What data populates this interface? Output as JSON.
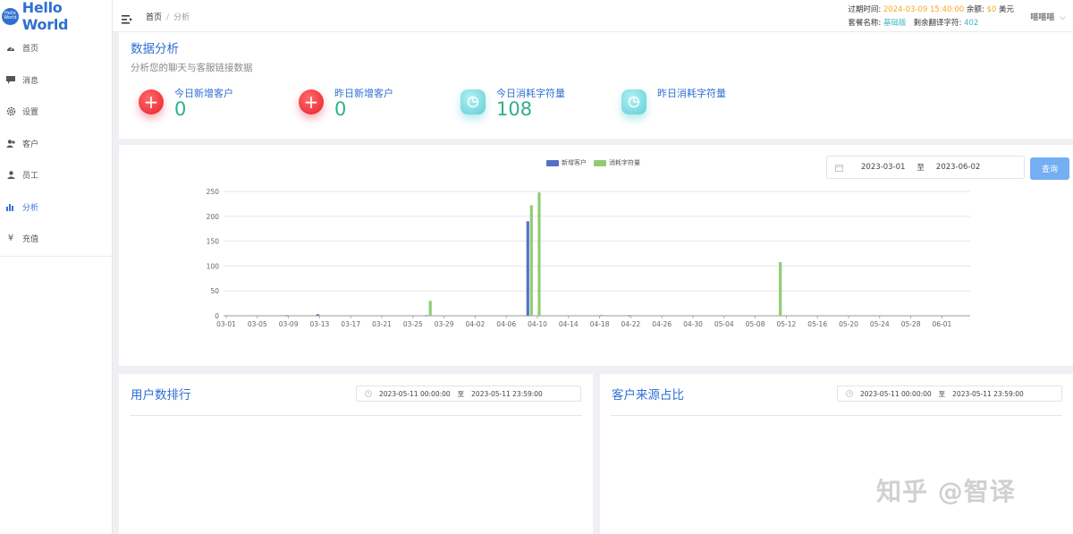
{
  "logo": {
    "badge": "Hello World",
    "text": "Hello World"
  },
  "sidebar": {
    "items": [
      {
        "label": "首页",
        "icon": "dashboard-icon"
      },
      {
        "label": "消息",
        "icon": "message-icon"
      },
      {
        "label": "设置",
        "icon": "gear-icon"
      },
      {
        "label": "客户",
        "icon": "users-icon"
      },
      {
        "label": "员工",
        "icon": "user-icon"
      },
      {
        "label": "分析",
        "icon": "bar-chart-icon",
        "active": true
      },
      {
        "label": "充值",
        "icon": "yen-icon"
      }
    ]
  },
  "header": {
    "breadcrumb": {
      "home": "首页",
      "sep": "/",
      "current": "分析"
    },
    "expiry_label": "过期时间:",
    "expiry_value": "2024-03-09 15:40:00",
    "balance_label": "余额:",
    "balance_value": "$0",
    "balance_unit": "美元",
    "plan_label": "套餐名称:",
    "plan_value": "基础版",
    "chars_label": "剩余翻译字符:",
    "chars_value": "402",
    "user": "喵喵喵"
  },
  "stats_panel": {
    "title": "数据分析",
    "subtitle": "分析您的聊天与客服链接数据",
    "stats": [
      {
        "label": "今日新增客户",
        "value": "0",
        "icon": "plus-icon"
      },
      {
        "label": "昨日新增客户",
        "value": "0",
        "icon": "plus-icon"
      },
      {
        "label": "今日消耗字符量",
        "value": "108",
        "icon": "pie-icon"
      },
      {
        "label": "昨日消耗字符量",
        "value": "",
        "icon": "pie-icon"
      }
    ]
  },
  "chart_panel": {
    "date_from": "2023-03-01",
    "date_to_sep": "至",
    "date_to": "2023-06-02",
    "query_button": "查询"
  },
  "chart_data": {
    "type": "bar",
    "title": "",
    "xlabel": "",
    "ylabel": "",
    "ylim": [
      0,
      250
    ],
    "yticks": [
      0,
      50,
      100,
      150,
      200,
      250
    ],
    "grid": true,
    "legend_position": "top-center",
    "x_tick_labels": [
      "03-01",
      "03-05",
      "03-09",
      "03-13",
      "03-17",
      "03-21",
      "03-25",
      "03-29",
      "04-02",
      "04-06",
      "04-10",
      "04-14",
      "04-18",
      "04-22",
      "04-26",
      "04-30",
      "05-04",
      "05-08",
      "05-12",
      "05-16",
      "05-20",
      "05-24",
      "05-28",
      "06-01"
    ],
    "x_start": "2023-03-01",
    "x_end": "2023-06-02",
    "series": [
      {
        "name": "新增客户",
        "color": "#5470c6",
        "points": [
          {
            "date": "2023-03-09",
            "value": 1
          },
          {
            "date": "2023-03-13",
            "value": 3
          },
          {
            "date": "2023-03-27",
            "value": 1
          },
          {
            "date": "2023-04-09",
            "value": 190
          },
          {
            "date": "2023-04-22",
            "value": 1
          }
        ]
      },
      {
        "name": "消耗字符量",
        "color": "#91cc75",
        "points": [
          {
            "date": "2023-03-27",
            "value": 30
          },
          {
            "date": "2023-04-09",
            "value": 222
          },
          {
            "date": "2023-04-10",
            "value": 248
          },
          {
            "date": "2023-04-18",
            "value": 2
          },
          {
            "date": "2023-05-11",
            "value": 108
          }
        ]
      }
    ]
  },
  "rank_panel": {
    "title": "用户数排行",
    "date_from": "2023-05-11 00:00:00",
    "date_to_sep": "至",
    "date_to": "2023-05-11 23:59:00"
  },
  "source_panel": {
    "title": "客户来源占比",
    "date_from": "2023-05-11 00:00:00",
    "date_to_sep": "至",
    "date_to": "2023-05-11 23:59:00"
  },
  "watermark": "知乎 @智译"
}
